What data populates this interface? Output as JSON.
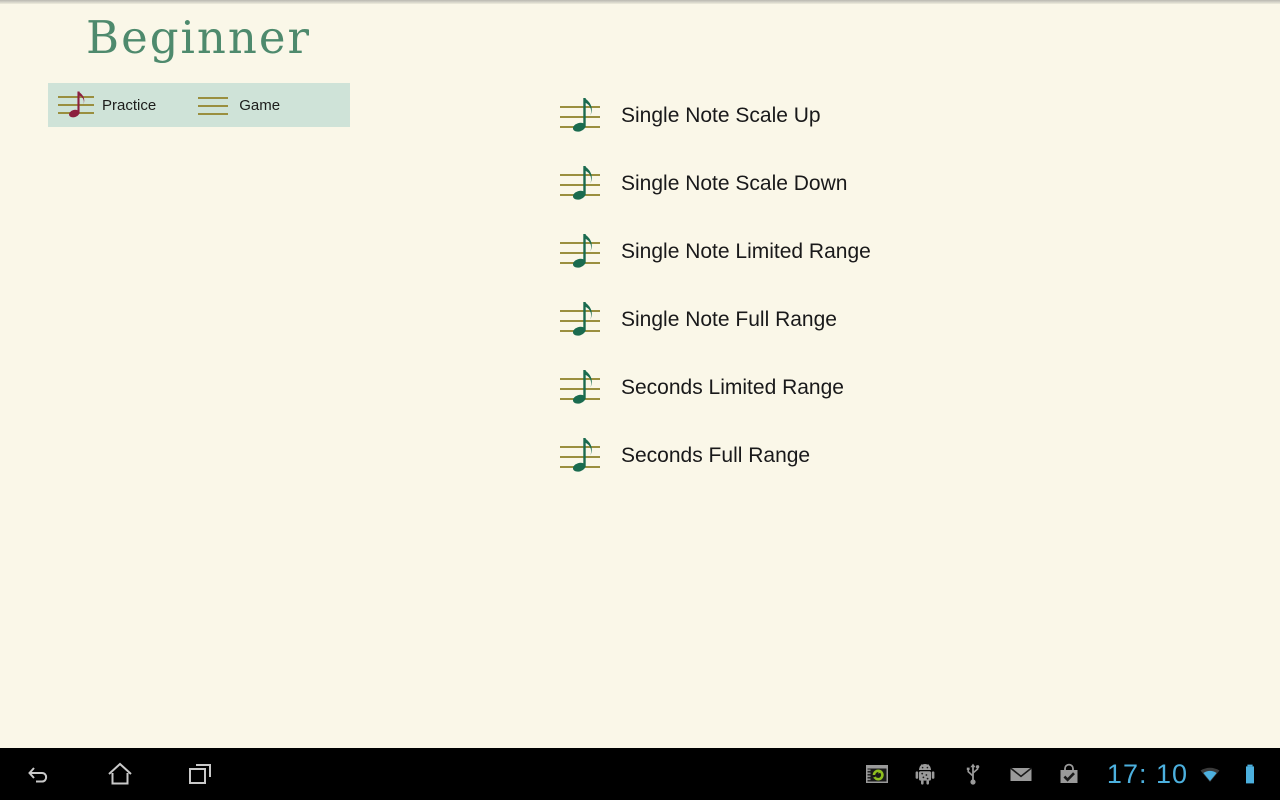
{
  "app": {
    "title": "Beginner",
    "title_color": "#4e8a6d",
    "background_color": "#faf7e8"
  },
  "tab_bar": {
    "background_color": "#cfe3d8",
    "tabs": [
      {
        "label": "Practice",
        "icon": "music-note-staff-icon",
        "selected": true,
        "icon_color": "#8c1f3f"
      },
      {
        "label": "Game",
        "icon": "staff-lines-icon",
        "selected": false,
        "icon_color": "#9a8f3f"
      }
    ]
  },
  "exercise_list": {
    "icon": "music-note-staff-icon",
    "icon_color": "#1a6b4f",
    "staff_color": "#9a8f3f",
    "items": [
      {
        "label": "Single Note Scale Up"
      },
      {
        "label": "Single Note Scale Down"
      },
      {
        "label": "Single Note Limited Range"
      },
      {
        "label": "Single Note Full Range"
      },
      {
        "label": "Seconds Limited Range"
      },
      {
        "label": "Seconds Full Range"
      }
    ]
  },
  "system_bar": {
    "background_color": "#000000",
    "nav_buttons": [
      {
        "name": "back-icon"
      },
      {
        "name": "home-icon"
      },
      {
        "name": "recents-icon"
      }
    ],
    "status_icons": [
      {
        "name": "sync-window-icon"
      },
      {
        "name": "android-debug-icon"
      },
      {
        "name": "usb-icon"
      },
      {
        "name": "email-icon"
      },
      {
        "name": "play-store-update-icon"
      }
    ],
    "clock": "17: 10",
    "clock_color": "#4cb0de",
    "wifi": "wifi-icon",
    "battery": "battery-full-icon"
  }
}
